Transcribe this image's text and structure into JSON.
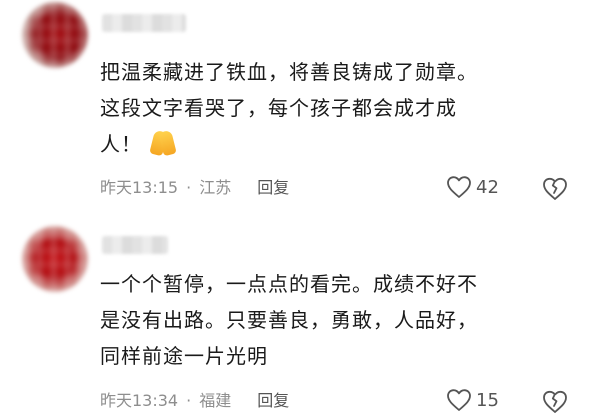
{
  "comments": [
    {
      "name": "",
      "lines": [
        "把温柔藏进了铁血，将善良铸成了勋章。",
        "这段文字看哭了，每个孩子都会成才成",
        "人！"
      ],
      "emoji": "folded-hands",
      "time": "昨天13:15",
      "separator": "·",
      "location": "江苏",
      "reply": "回复",
      "likes": "42"
    },
    {
      "name": "",
      "lines": [
        "一个个暂停，一点点的看完。成绩不好不",
        "是没有出路。只要善良，勇敢，人品好，",
        "同样前途一片光明"
      ],
      "time": "昨天13:34",
      "separator": "·",
      "location": "福建",
      "reply": "回复",
      "likes": "15"
    }
  ],
  "icons": {
    "like": "heart-outline-icon",
    "dislike": "broken-heart-icon"
  },
  "colors": {
    "text": "#1a1a1a",
    "meta": "#8e8e8e",
    "icon": "#555555",
    "avatar_red": "#a50f14"
  }
}
